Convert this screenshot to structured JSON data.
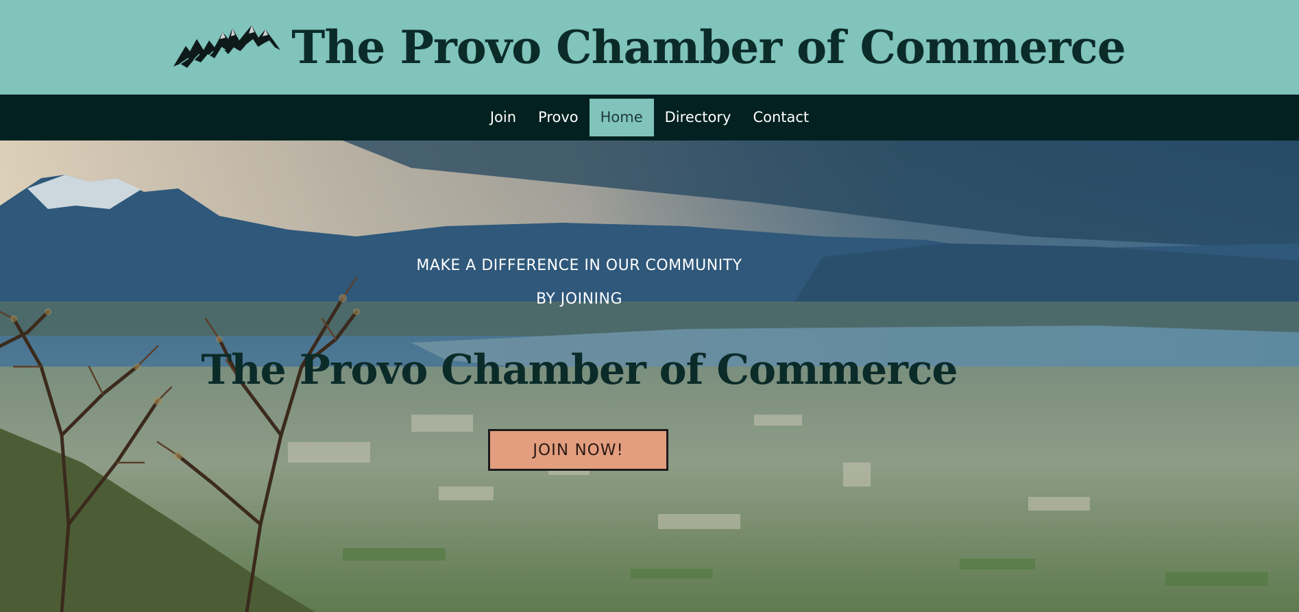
{
  "header": {
    "title": "The Provo Chamber of Commerce",
    "logo_icon": "mountain-icon"
  },
  "nav": {
    "items": [
      {
        "label": "Join",
        "active": false
      },
      {
        "label": "Provo",
        "active": false
      },
      {
        "label": "Home",
        "active": true
      },
      {
        "label": "Directory",
        "active": false
      },
      {
        "label": "Contact",
        "active": false
      }
    ]
  },
  "hero": {
    "tagline_line1": "MAKE A DIFFERENCE IN OUR COMMUNITY",
    "tagline_line2": "BY JOINING",
    "title": "The Provo Chamber of Commerce",
    "cta_label": "JOIN NOW!"
  },
  "colors": {
    "header_bg": "#80c4bb",
    "nav_bg": "#032120",
    "nav_active_bg": "#80c4bb",
    "title_text": "#0b2b29",
    "cta_bg": "#e39e7f"
  }
}
